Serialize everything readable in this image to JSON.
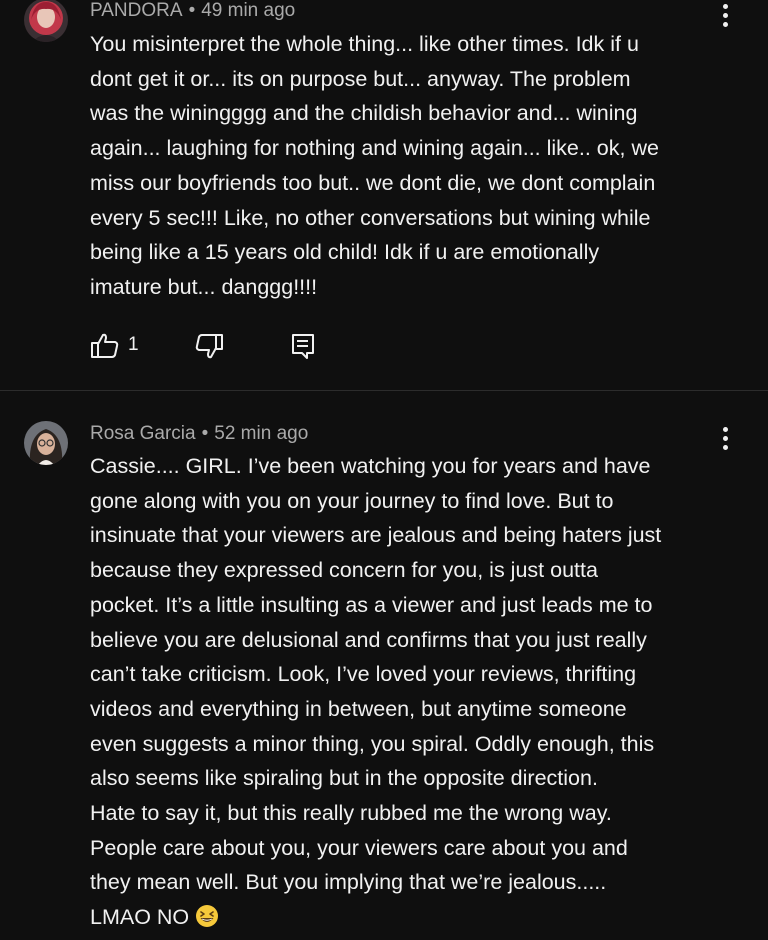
{
  "comments": [
    {
      "author": "PANDORA",
      "separator": "•",
      "time": "49 min ago",
      "avatar_icon": "avatar-icon",
      "lines": [
        "You misinterpret the whole thing... like other times. Idk if u",
        "dont get it or... its on purpose but... anyway. The problem",
        "was the winingggg and the childish behavior and... wining",
        "again... laughing for nothing and wining again... like.. ok, we",
        "miss our boyfriends too but.. we dont die, we dont complain",
        "every 5 sec!!! Like, no other conversations but wining while",
        "being like a 15 years old child! Idk if u are emotionally",
        "imature but... danggg!!!!"
      ],
      "like_count": "1",
      "icons": [
        "thumbs-up-icon",
        "thumbs-down-icon",
        "reply-icon",
        "more-vertical-icon"
      ]
    },
    {
      "author": "Rosa Garcia",
      "separator": "•",
      "time": "52 min ago",
      "avatar_icon": "avatar-icon",
      "lines": [
        "Cassie.... GIRL. I’ve been watching you for years and have",
        "gone along with you on your journey to find love. But to",
        "insinuate that your viewers are jealous and being haters just",
        "because they expressed concern for you, is just outta",
        "pocket. It’s a little insulting as a viewer and just leads me to",
        "believe you are delusional and confirms that you just really",
        "can’t take criticism. Look, I’ve loved your reviews, thrifting",
        "videos and everything in between, but anytime someone",
        "even suggests a minor thing, you spiral. Oddly enough, this",
        "also seems like spiraling but in the opposite direction.",
        "Hate to say it, but this really rubbed me the wrong way.",
        "People care about you, your viewers care about you and",
        "they mean well. But you implying that we’re jealous.....",
        "LMAO NO"
      ],
      "trailing_emoji": "grinning-squinting-face-emoji",
      "icons": [
        "more-vertical-icon"
      ]
    }
  ],
  "colors": {
    "background": "#0f0f0f",
    "text_primary": "#f1f1f1",
    "text_secondary": "#aaaaaa",
    "divider": "#2c2c2c"
  }
}
